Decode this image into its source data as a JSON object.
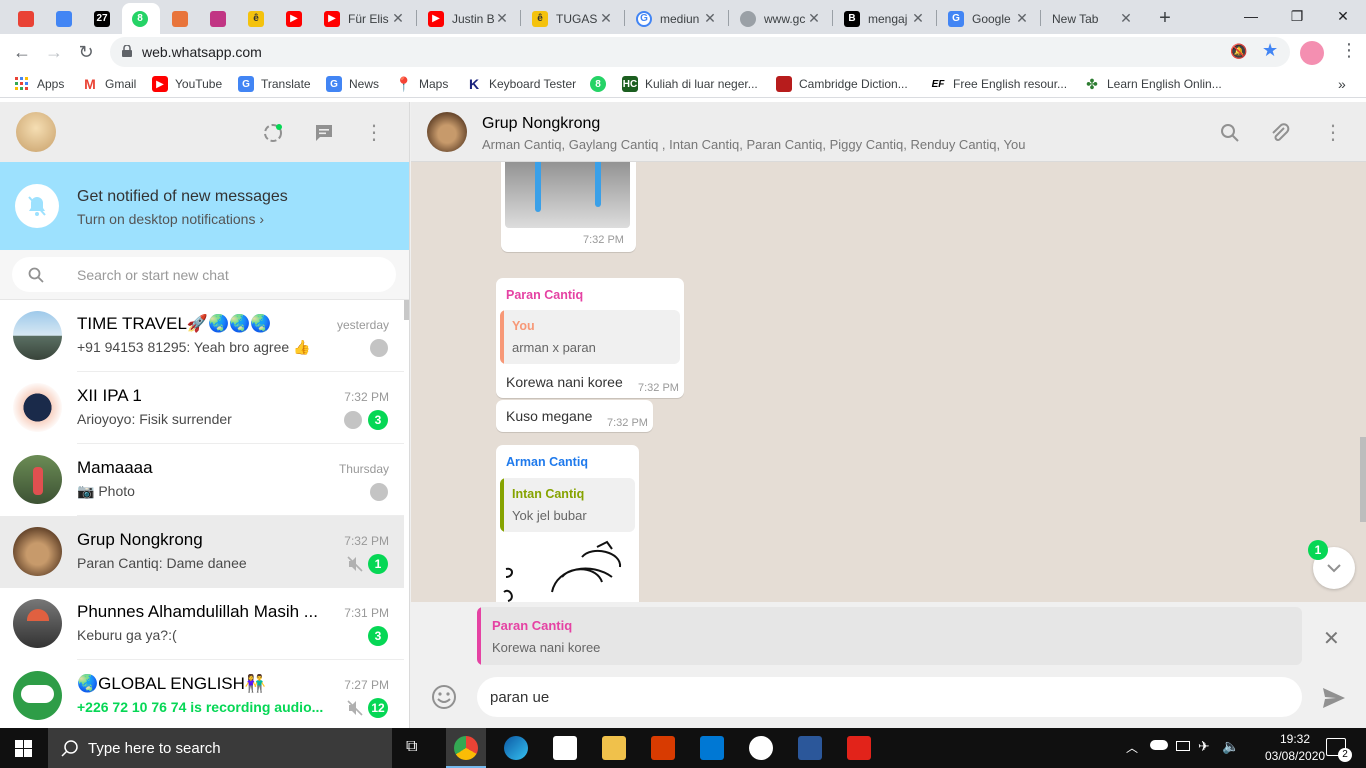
{
  "browser": {
    "tabs": [
      {
        "title": ""
      },
      {
        "title": ""
      },
      {
        "title": ""
      },
      {
        "title": ""
      },
      {
        "title": ""
      },
      {
        "title": ""
      },
      {
        "title": ""
      },
      {
        "title": ""
      },
      {
        "title": "Für Elis"
      },
      {
        "title": "Justin B"
      },
      {
        "title": "TUGAS"
      },
      {
        "title": "mediun"
      },
      {
        "title": "www.gc"
      },
      {
        "title": "mengaj"
      },
      {
        "title": "Google"
      },
      {
        "title": "New Tab"
      }
    ],
    "url": "web.whatsapp.com",
    "bookmarks": [
      {
        "label": "Apps"
      },
      {
        "label": "Gmail"
      },
      {
        "label": "YouTube"
      },
      {
        "label": "Translate"
      },
      {
        "label": "News"
      },
      {
        "label": "Maps"
      },
      {
        "label": "Keyboard Tester"
      },
      {
        "label": ""
      },
      {
        "label": "Kuliah di luar neger..."
      },
      {
        "label": "Cambridge Diction..."
      },
      {
        "label": "Free English resour..."
      },
      {
        "label": "Learn English Onlin..."
      }
    ]
  },
  "notification": {
    "title": "Get notified of new messages",
    "subtitle": "Turn on desktop notifications ›"
  },
  "search": {
    "placeholder": "Search or start new chat"
  },
  "chats": [
    {
      "name": "TIME TRAVEL🚀🌏🌏🌏",
      "time": "yesterday",
      "message": "+91 94153 81295: Yeah bro agree 👍",
      "badge": ""
    },
    {
      "name": "XII IPA 1",
      "time": "7:32 PM",
      "message": "Arioyoyo: Fisik surrender",
      "badge": "3"
    },
    {
      "name": "Mamaaaa",
      "time": "Thursday",
      "message": "📷 Photo",
      "badge": ""
    },
    {
      "name": "Grup Nongkrong",
      "time": "7:32 PM",
      "message": "Paran Cantiq: Dame danee",
      "badge": "1"
    },
    {
      "name": "Phunnes Alhamdulillah Masih ...",
      "time": "7:31 PM",
      "message": "Keburu ga ya?:(",
      "badge": "3"
    },
    {
      "name": "🌏GLOBAL ENGLISH👫",
      "time": "7:27 PM",
      "message": "+226 72 10 76 74 is recording audio...",
      "badge": "12"
    }
  ],
  "conversation": {
    "title": "Grup Nongkrong",
    "members": "Arman Cantiq, Gaylang Cantiq , Intan Cantiq, Paran Cantiq, Piggy Cantiq, Renduy Cantiq, You",
    "image_time": "7:32 PM",
    "messages": [
      {
        "sender": "Paran Cantiq",
        "quote_sender": "You",
        "quote_text": "arman x paran",
        "text": "Korewa nani koree",
        "time": "7:32 PM"
      },
      {
        "text": "Kuso megane",
        "time": "7:32 PM"
      },
      {
        "sender": "Arman Cantiq",
        "quote_sender": "Intan Cantiq",
        "quote_text": "Yok jel bubar"
      }
    ],
    "scroll_badge": "1",
    "reply": {
      "sender": "Paran Cantiq",
      "text": "Korewa nani koree"
    },
    "draft": "paran ue"
  },
  "taskbar": {
    "search_placeholder": "Type here to search",
    "time": "19:32",
    "date": "03/08/2020",
    "notif_count": "2"
  },
  "colors": {
    "whatsapp_green": "#06d755",
    "paran_color": "#e542a3",
    "arman_color": "#1f7aec",
    "you_color": "#f79877",
    "intan_color": "#86a300"
  }
}
